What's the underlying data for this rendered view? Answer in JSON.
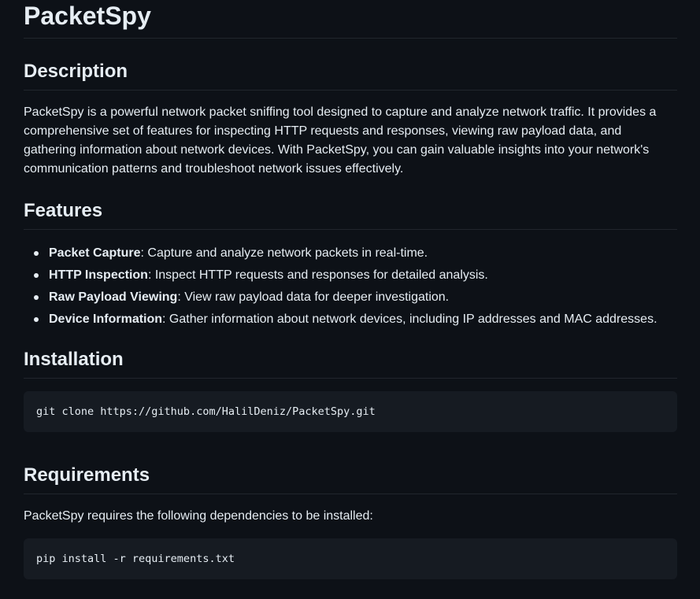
{
  "title": "PacketSpy",
  "description": {
    "heading": "Description",
    "text": "PacketSpy is a powerful network packet sniffing tool designed to capture and analyze network traffic. It provides a comprehensive set of features for inspecting HTTP requests and responses, viewing raw payload data, and gathering information about network devices. With PacketSpy, you can gain valuable insights into your network's communication patterns and troubleshoot network issues effectively."
  },
  "features": {
    "heading": "Features",
    "items": [
      {
        "name": "Packet Capture",
        "text": ": Capture and analyze network packets in real-time."
      },
      {
        "name": "HTTP Inspection",
        "text": ": Inspect HTTP requests and responses for detailed analysis."
      },
      {
        "name": "Raw Payload Viewing",
        "text": ": View raw payload data for deeper investigation."
      },
      {
        "name": "Device Information",
        "text": ": Gather information about network devices, including IP addresses and MAC addresses."
      }
    ]
  },
  "installation": {
    "heading": "Installation",
    "code": "git clone https://github.com/HalilDeniz/PacketSpy.git"
  },
  "requirements": {
    "heading": "Requirements",
    "text": "PacketSpy requires the following dependencies to be installed:",
    "code": "pip install -r requirements.txt"
  }
}
